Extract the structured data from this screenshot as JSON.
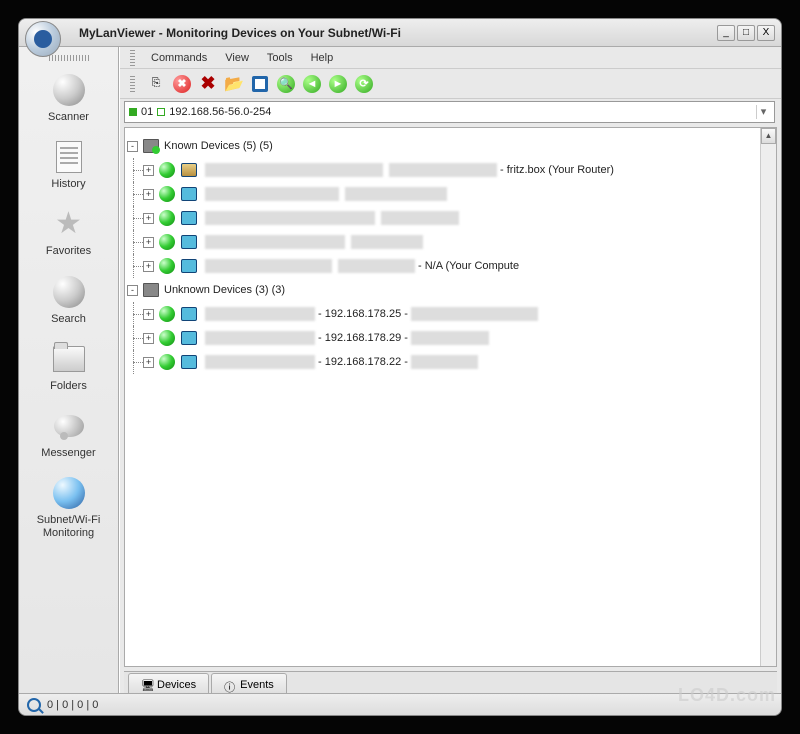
{
  "title": "MyLanViewer - Monitoring Devices on Your Subnet/Wi-Fi",
  "window_buttons": {
    "min": "_",
    "max": "□",
    "close": "X"
  },
  "sidebar": {
    "items": [
      {
        "label": "Scanner",
        "icon": "globe-icon"
      },
      {
        "label": "History",
        "icon": "document-icon"
      },
      {
        "label": "Favorites",
        "icon": "star-icon"
      },
      {
        "label": "Search",
        "icon": "search-globe-icon"
      },
      {
        "label": "Folders",
        "icon": "folders-icon"
      },
      {
        "label": "Messenger",
        "icon": "bubble-icon"
      },
      {
        "label": "Subnet/Wi-Fi Monitoring",
        "icon": "blue-globe-icon"
      }
    ]
  },
  "menu": [
    "Commands",
    "View",
    "Tools",
    "Help"
  ],
  "toolbar": [
    {
      "name": "export-icon"
    },
    {
      "name": "stop-icon"
    },
    {
      "name": "delete-icon"
    },
    {
      "name": "open-folder-icon"
    },
    {
      "name": "save-icon"
    },
    {
      "name": "zoom-icon"
    },
    {
      "name": "back-icon"
    },
    {
      "name": "forward-icon"
    },
    {
      "name": "refresh-icon"
    }
  ],
  "address": {
    "prefix": "01",
    "range": "192.168.56-56.0-254"
  },
  "tree": {
    "known": {
      "title": "Known Devices (5) (5)",
      "rows": [
        {
          "suffix": " - fritz.box (Your Router)",
          "router": true
        },
        {
          "suffix": ""
        },
        {
          "suffix": ""
        },
        {
          "suffix": ""
        },
        {
          "suffix": " - N/A (Your Compute"
        }
      ]
    },
    "unknown": {
      "title": "Unknown Devices (3) (3)",
      "rows": [
        {
          "ip": " - 192.168.178.25 - "
        },
        {
          "ip": " - 192.168.178.29 - "
        },
        {
          "ip": " - 192.168.178.22 - "
        }
      ]
    }
  },
  "bottom_tabs": [
    "Devices",
    "Events"
  ],
  "status": "0 | 0 | 0 | 0",
  "watermark": "LO4D.com"
}
